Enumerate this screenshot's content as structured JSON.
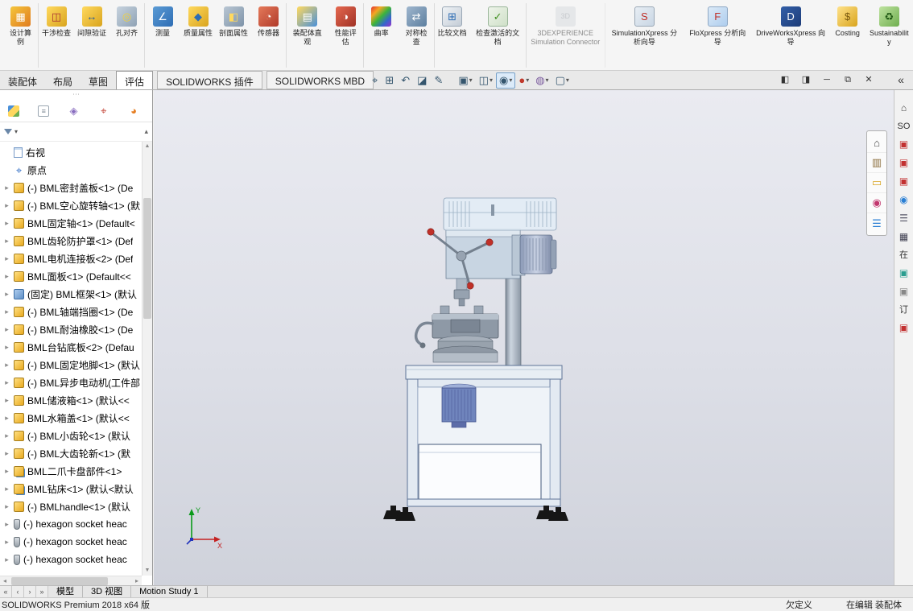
{
  "ribbon": {
    "items": [
      {
        "name": "design-study-button",
        "icon": "design-study-icon",
        "glyph": "▦",
        "label": "设计算例"
      },
      {
        "name": "interference-check-button",
        "icon": "interference-check-icon",
        "glyph": "◫",
        "label": "干涉检查"
      },
      {
        "name": "clearance-verification-button",
        "icon": "clearance-verification-icon",
        "glyph": "↔",
        "label": "间隙验证"
      },
      {
        "name": "hole-alignment-button",
        "icon": "hole-alignment-icon",
        "glyph": "◎",
        "label": "孔对齐"
      },
      {
        "name": "measure-button",
        "icon": "measure-icon",
        "glyph": "∠",
        "label": "测量"
      },
      {
        "name": "mass-properties-button",
        "icon": "mass-properties-icon",
        "glyph": "◆",
        "label": "质量属性"
      },
      {
        "name": "section-properties-button",
        "icon": "section-properties-icon",
        "glyph": "◧",
        "label": "剖面属性"
      },
      {
        "name": "sensors-button",
        "icon": "sensors-icon",
        "glyph": "◔",
        "label": "传感器"
      },
      {
        "name": "assembly-visualization-button",
        "icon": "assembly-visualization-icon",
        "glyph": "▤",
        "label": "装配体直观"
      },
      {
        "name": "performance-evaluation-button",
        "icon": "performance-evaluation-icon",
        "glyph": "◑",
        "label": "性能评估"
      },
      {
        "name": "curvature-button",
        "icon": "curvature-icon",
        "glyph": "",
        "label": "曲率"
      },
      {
        "name": "symmetry-check-button",
        "icon": "symmetry-check-icon",
        "glyph": "⇄",
        "label": "对称检查"
      },
      {
        "name": "compare-documents-button",
        "icon": "compare-documents-icon",
        "glyph": "⊞",
        "label": "比较文档"
      },
      {
        "name": "check-active-document-button",
        "icon": "check-active-document-icon",
        "glyph": "✓",
        "label": "检查激活的文档"
      },
      {
        "name": "threedexperience-connector-button",
        "icon": "threedexperience-icon",
        "glyph": "3D",
        "label": "3DEXPERIENCE Simulation Connector"
      },
      {
        "name": "simulationxpress-button",
        "icon": "simulationxpress-icon",
        "glyph": "S",
        "label": "SimulationXpress 分析向导"
      },
      {
        "name": "floxpress-button",
        "icon": "floxpress-icon",
        "glyph": "F",
        "label": "FloXpress 分析向导"
      },
      {
        "name": "driveworksxpress-button",
        "icon": "driveworksxpress-icon",
        "glyph": "D",
        "label": "DriveWorksXpress 向导"
      },
      {
        "name": "costing-button",
        "icon": "costing-icon",
        "glyph": "$",
        "label": "Costing"
      },
      {
        "name": "sustainability-button",
        "icon": "sustainability-icon",
        "glyph": "♻",
        "label": "Sustainability"
      }
    ]
  },
  "command_tabs": {
    "tabs": [
      {
        "label": "装配体"
      },
      {
        "label": "布局"
      },
      {
        "label": "草图"
      },
      {
        "label": "评估"
      },
      {
        "label": "SOLIDWORKS 插件"
      },
      {
        "label": "SOLIDWORKS MBD"
      }
    ],
    "active_tab": "评估"
  },
  "view_toolbar": {
    "items": [
      {
        "name": "zoom-fit-button",
        "icon": "zoom-fit-icon",
        "glyph": "⌖",
        "arrow": ""
      },
      {
        "name": "zoom-area-button",
        "icon": "zoom-area-icon",
        "glyph": "⊞",
        "arrow": ""
      },
      {
        "name": "previous-view-button",
        "icon": "previous-view-icon",
        "glyph": "↶",
        "arrow": ""
      },
      {
        "name": "section-view-button",
        "icon": "section-view-icon",
        "glyph": "◪",
        "arrow": ""
      },
      {
        "name": "dynamic-annotations-button",
        "icon": "dynamic-annotations-icon",
        "glyph": "✎",
        "arrow": ""
      },
      {
        "name": "view-orientation-button",
        "icon": "view-orientation-icon",
        "glyph": "▣",
        "arrow": "▾"
      },
      {
        "name": "display-style-button",
        "icon": "display-style-icon",
        "glyph": "◫",
        "arrow": "▾"
      },
      {
        "name": "hide-show-items-button",
        "icon": "hide-show-items-icon",
        "glyph": "◉",
        "arrow": "▾"
      },
      {
        "name": "edit-appearance-button",
        "icon": "edit-appearance-icon",
        "glyph": "●",
        "arrow": "▾"
      },
      {
        "name": "apply-scene-button",
        "icon": "apply-scene-icon",
        "glyph": "◍",
        "arrow": "▾"
      },
      {
        "name": "view-settings-button",
        "icon": "view-settings-icon",
        "glyph": "▢",
        "arrow": "▾"
      }
    ]
  },
  "window_controls": {
    "items": [
      {
        "name": "dock-left-pane-button",
        "glyph": "◧"
      },
      {
        "name": "dock-right-pane-button",
        "glyph": "◨"
      },
      {
        "name": "minimize-window-button",
        "glyph": "─"
      },
      {
        "name": "restore-window-button",
        "glyph": "⧉"
      },
      {
        "name": "close-window-button",
        "glyph": "✕"
      }
    ],
    "collapse_taskpane_glyph": "«"
  },
  "left_panel": {
    "gripper_glyph": "⋯",
    "tabs": [
      {
        "name": "featuremanager-tab",
        "glyph": ""
      },
      {
        "name": "propertymanager-tab",
        "glyph": "≡"
      },
      {
        "name": "configurationmanager-tab",
        "glyph": "◈"
      },
      {
        "name": "dimxpertmanager-tab",
        "glyph": "⌖"
      },
      {
        "name": "displaymanager-tab",
        "glyph": "◕"
      }
    ],
    "filter": {
      "dropdown_glyph": "▾",
      "collapse_glyph": "▴"
    },
    "tree": {
      "items": [
        {
          "icon": "plane-icon",
          "glyph": "",
          "arrow": "",
          "label": "右视"
        },
        {
          "icon": "origin-icon",
          "glyph": "⌖",
          "arrow": "",
          "label": "原点"
        },
        {
          "icon": "part-icon",
          "glyph": "",
          "arrow": "▸",
          "label": "(-) BML密封盖板<1> (De"
        },
        {
          "icon": "part-icon",
          "glyph": "",
          "arrow": "▸",
          "label": "(-) BML空心旋转轴<1> (默"
        },
        {
          "icon": "part-icon",
          "glyph": "",
          "arrow": "▸",
          "label": "BML固定轴<1> (Default<"
        },
        {
          "icon": "part-icon",
          "glyph": "",
          "arrow": "▸",
          "label": "BML齿轮防护罩<1> (Def"
        },
        {
          "icon": "part-icon",
          "glyph": "",
          "arrow": "▸",
          "label": "BML电机连接板<2> (Def"
        },
        {
          "icon": "part-icon",
          "glyph": "",
          "arrow": "▸",
          "label": "BML面板<1> (Default<<"
        },
        {
          "icon": "part-blue-icon",
          "glyph": "",
          "arrow": "▸",
          "label": "(固定) BML框架<1> (默认"
        },
        {
          "icon": "part-icon",
          "glyph": "",
          "arrow": "▸",
          "label": "(-) BML轴端挡圈<1> (De"
        },
        {
          "icon": "part-icon",
          "glyph": "",
          "arrow": "▸",
          "label": "(-) BML耐油橡胶<1> (De"
        },
        {
          "icon": "part-icon",
          "glyph": "",
          "arrow": "▸",
          "label": "BML台钻底板<2> (Defau"
        },
        {
          "icon": "part-icon",
          "glyph": "",
          "arrow": "▸",
          "label": "(-) BML固定地脚<1> (默认"
        },
        {
          "icon": "part-icon",
          "glyph": "",
          "arrow": "▸",
          "label": "(-) BML异步电动机(工件部"
        },
        {
          "icon": "part-icon",
          "glyph": "",
          "arrow": "▸",
          "label": "BML储液箱<1> (默认<<"
        },
        {
          "icon": "part-icon",
          "glyph": "",
          "arrow": "▸",
          "label": "BML水箱盖<1> (默认<<"
        },
        {
          "icon": "part-icon",
          "glyph": "",
          "arrow": "▸",
          "label": "(-) BML小齿轮<1> (默认"
        },
        {
          "icon": "part-icon",
          "glyph": "",
          "arrow": "▸",
          "label": "(-) BML大齿轮新<1> (默"
        },
        {
          "icon": "assembly-icon",
          "glyph": "",
          "arrow": "▸",
          "label": "BML二爪卡盘部件<1>"
        },
        {
          "icon": "assembly-icon",
          "glyph": "",
          "arrow": "▸",
          "label": "BML钻床<1> (默认<默认"
        },
        {
          "icon": "part-icon",
          "glyph": "",
          "arrow": "▸",
          "label": "(-) BMLhandle<1> (默认"
        },
        {
          "icon": "bolt-icon",
          "glyph": "",
          "arrow": "▸",
          "label": "(-) hexagon socket heac"
        },
        {
          "icon": "bolt-icon",
          "glyph": "",
          "arrow": "▸",
          "label": "(-) hexagon socket heac"
        },
        {
          "icon": "bolt-icon",
          "glyph": "",
          "arrow": "▸",
          "label": "(-) hexagon socket heac"
        }
      ]
    }
  },
  "viewport": {
    "triad": {
      "x_label": "X",
      "y_label": "Y"
    }
  },
  "task_pane_tabs": {
    "items": [
      {
        "name": "solidworks-resources-tab",
        "glyph": "⌂"
      },
      {
        "name": "design-library-tab",
        "glyph": "▥"
      },
      {
        "name": "file-explorer-tab",
        "glyph": "▭"
      },
      {
        "name": "appearances-scenes-tab",
        "glyph": "◉"
      },
      {
        "name": "custom-properties-tab",
        "glyph": "☰"
      }
    ]
  },
  "task_strip": {
    "items": [
      {
        "name": "taskpane-home-icon",
        "glyph": "⌂",
        "label": ""
      },
      {
        "name": "taskpane-text-fragment",
        "glyph": "",
        "label": "SO"
      },
      {
        "name": "taskpane-red-icon-1",
        "glyph": "▣",
        "label": ""
      },
      {
        "name": "taskpane-red-icon-2",
        "glyph": "▣",
        "label": ""
      },
      {
        "name": "taskpane-red-icon-3",
        "glyph": "▣",
        "label": ""
      },
      {
        "name": "taskpane-sphere-icon",
        "glyph": "◉",
        "label": ""
      },
      {
        "name": "taskpane-list-icon",
        "glyph": "☰",
        "label": ""
      },
      {
        "name": "taskpane-grid-icon",
        "glyph": "▦",
        "label": ""
      },
      {
        "name": "taskpane-text-fragment",
        "glyph": "",
        "label": "在"
      },
      {
        "name": "taskpane-teal-icon",
        "glyph": "▣",
        "label": ""
      },
      {
        "name": "taskpane-gray-icon",
        "glyph": "▣",
        "label": ""
      },
      {
        "name": "taskpane-text-fragment",
        "glyph": "",
        "label": "订"
      },
      {
        "name": "taskpane-red-icon-4",
        "glyph": "▣",
        "label": ""
      }
    ]
  },
  "bottom_bar": {
    "nav": [
      {
        "name": "first-tab-button",
        "glyph": "«"
      },
      {
        "name": "previous-tab-button",
        "glyph": "‹"
      },
      {
        "name": "next-tab-button",
        "glyph": "›"
      },
      {
        "name": "last-tab-button",
        "glyph": "»"
      }
    ],
    "tabs": [
      {
        "label": "模型"
      },
      {
        "label": "3D 视图"
      },
      {
        "label": "Motion Study 1"
      }
    ],
    "active_tab": "模型"
  },
  "status_bar": {
    "left": "SOLIDWORKS Premium 2018 x64 版",
    "right": [
      "欠定义",
      "在编辑 装配体"
    ]
  }
}
